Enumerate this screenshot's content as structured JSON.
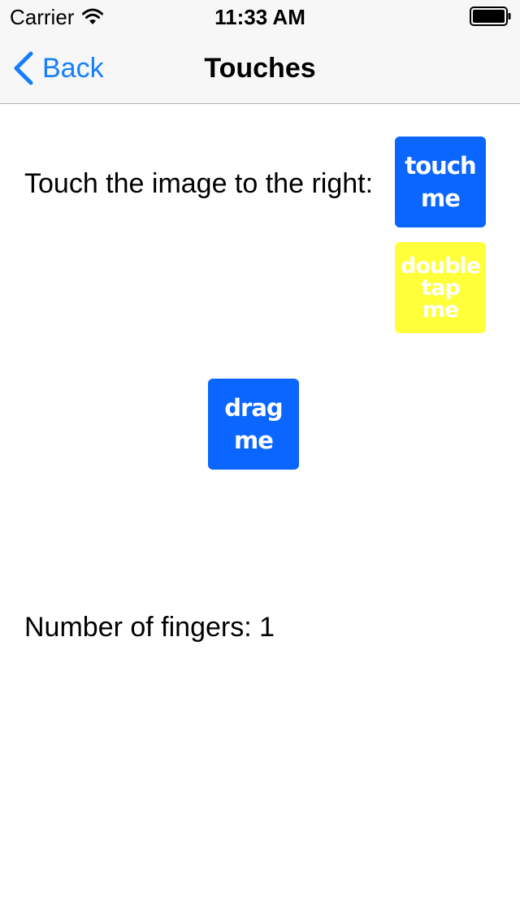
{
  "status_bar": {
    "carrier": "Carrier",
    "time": "11:33 AM",
    "icons": [
      "wifi-icon",
      "battery-icon"
    ]
  },
  "nav_bar": {
    "back_label": "Back",
    "title": "Touches",
    "accent_color": "#157efb"
  },
  "content": {
    "instruction": "Touch the image to the right:",
    "touch_tile": {
      "text": "touch\nme",
      "color": "#0a66ff"
    },
    "double_tap_tile": {
      "text": "double\ntap\nme",
      "color": "#ffff3a"
    },
    "drag_tile": {
      "text": "drag\nme",
      "color": "#0a66ff"
    },
    "fingers_label": "Number of fingers: 1"
  }
}
